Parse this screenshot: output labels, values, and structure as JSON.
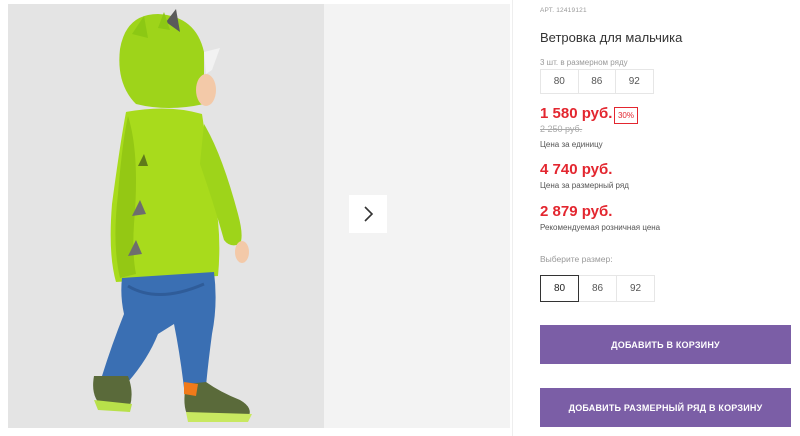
{
  "product": {
    "sku": "АРТ. 12419121",
    "title": "Ветровка для мальчика"
  },
  "size_set": {
    "label": "3 шт. в размерном ряду",
    "sizes": [
      "80",
      "86",
      "92"
    ]
  },
  "prices": {
    "unit_price": "1 580 руб.",
    "discount": "30%",
    "old_price": "2 250 руб.",
    "unit_caption": "Цена за единицу",
    "set_price": "4 740 руб.",
    "set_caption": "Цена за размерный ряд",
    "retail_price": "2 879 руб.",
    "retail_caption": "Рекомендуемая розничная цена"
  },
  "size_select": {
    "label": "Выберите размер:",
    "sizes": [
      "80",
      "86",
      "92"
    ],
    "selected": "80"
  },
  "buttons": {
    "add_to_cart": "ДОБАВИТЬ В КОРЗИНУ",
    "add_set_to_cart": "ДОБАВИТЬ РАЗМЕРНЫЙ РЯД В КОРЗИНУ"
  },
  "colors": {
    "accent": "#7b5ea6",
    "price": "#e3262f"
  },
  "icons": {
    "next": "chevron-right-icon"
  }
}
